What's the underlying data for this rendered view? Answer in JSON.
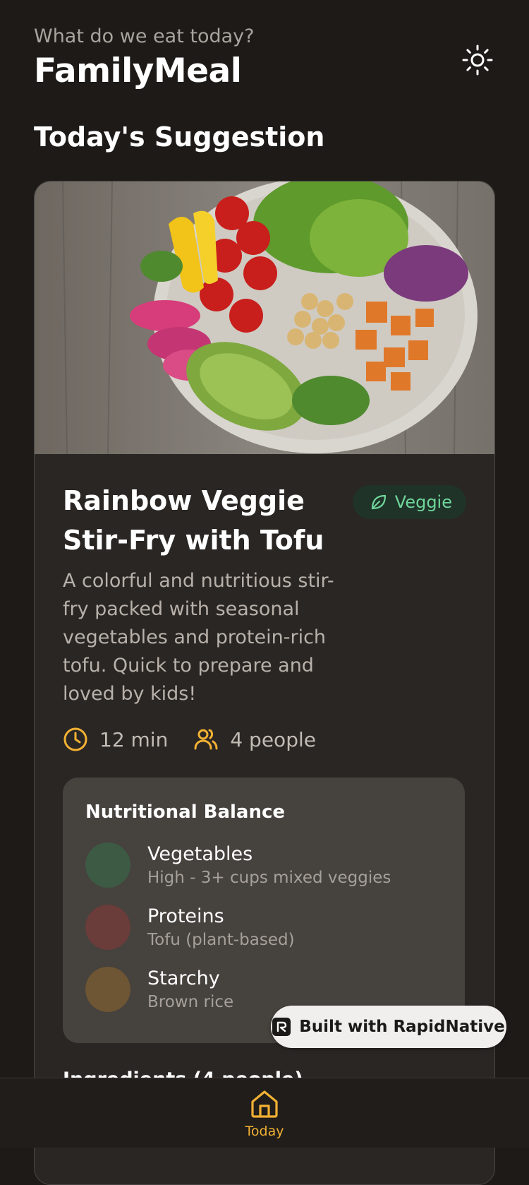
{
  "header": {
    "subtitle": "What do we eat today?",
    "app_title": "FamilyMeal",
    "theme_icon": "sun-icon"
  },
  "section_title": "Today's Suggestion",
  "recipe": {
    "image_icon": "food-bowl-image",
    "title": "Rainbow Veggie Stir-Fry with Tofu",
    "tag": "Veggie",
    "tag_icon": "leaf-icon",
    "description": "A colorful and nutritious stir-fry packed with seasonal vegetables and protein-rich tofu. Quick to prepare and loved by kids!",
    "time": "12 min",
    "people": "4 people"
  },
  "nutrition": {
    "title": "Nutritional Balance",
    "items": [
      {
        "name": "Vegetables",
        "detail": "High - 3+ cups mixed veggies",
        "color": "#3c5a44"
      },
      {
        "name": "Proteins",
        "detail": "Tofu (plant-based)",
        "color": "#6a3c3a"
      },
      {
        "name": "Starchy",
        "detail": "Brown rice",
        "color": "#6e5533"
      }
    ]
  },
  "ingredients_title": "Ingredients (4 people)",
  "badge": {
    "label": "Built with RapidNative"
  },
  "tabbar": {
    "items": [
      {
        "label": "Today",
        "icon": "home-icon"
      }
    ]
  },
  "colors": {
    "accent": "#f2b133",
    "veggie_green": "#6fd59a",
    "background": "#1d1a18",
    "card": "#2a2624"
  }
}
